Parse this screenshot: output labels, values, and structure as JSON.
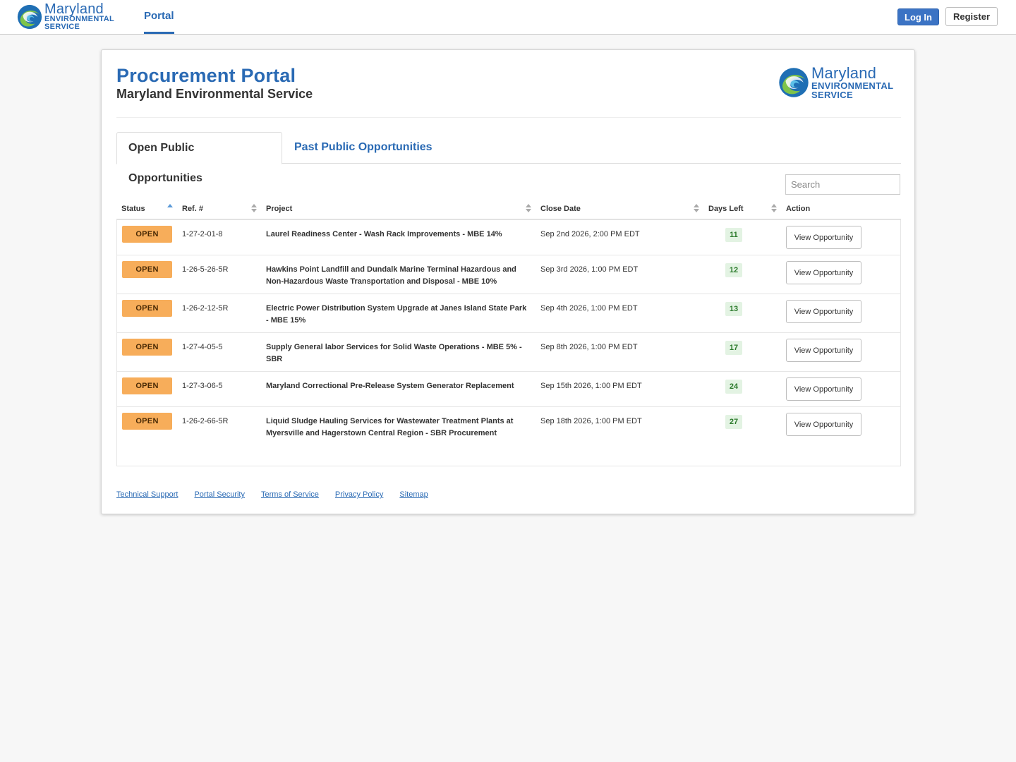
{
  "header": {
    "brand": {
      "word1": "Maryland",
      "word2": "ENVIRONMENTAL",
      "word3": "SERVICE"
    },
    "nav_portal": "Portal",
    "login_label": "Log In",
    "register_label": "Register"
  },
  "card": {
    "title": "Procurement Portal",
    "subtitle": "Maryland Environmental Service",
    "logo": {
      "word1": "Maryland",
      "word2": "ENVIRONMENTAL",
      "word3": "SERVICE"
    },
    "tabs": [
      {
        "label": "Open Public Opportunities",
        "active": true
      },
      {
        "label": "Past Public Opportunities",
        "active": false
      }
    ],
    "search_placeholder": "Search"
  },
  "table": {
    "columns": [
      "Status",
      "Ref. #",
      "Project",
      "Close Date",
      "Days Left",
      "Action"
    ],
    "rows": [
      {
        "status": "OPEN",
        "ref": "1-27-2-01-8",
        "project": "Laurel Readiness Center - Wash Rack Improvements - MBE 14%",
        "close": "Sep 2nd 2026, 2:00 PM EDT",
        "days": "11",
        "action": "View Opportunity"
      },
      {
        "status": "OPEN",
        "ref": "1-26-5-26-5R",
        "project": "Hawkins Point Landfill and Dundalk Marine Terminal Hazardous and Non-Hazardous Waste Transportation and Disposal - MBE 10%",
        "close": "Sep 3rd 2026, 1:00 PM EDT",
        "days": "12",
        "action": "View Opportunity"
      },
      {
        "status": "OPEN",
        "ref": "1-26-2-12-5R",
        "project": "Electric Power Distribution System Upgrade at Janes Island State Park - MBE 15%",
        "close": "Sep 4th 2026, 1:00 PM EDT",
        "days": "13",
        "action": "View Opportunity"
      },
      {
        "status": "OPEN",
        "ref": "1-27-4-05-5",
        "project": "Supply General labor Services for Solid Waste Operations - MBE 5% - SBR",
        "close": "Sep 8th 2026, 1:00 PM EDT",
        "days": "17",
        "action": "View Opportunity"
      },
      {
        "status": "OPEN",
        "ref": "1-27-3-06-5",
        "project": "Maryland Correctional Pre-Release System Generator Replacement",
        "close": "Sep 15th 2026, 1:00 PM EDT",
        "days": "24",
        "action": "View Opportunity"
      },
      {
        "status": "OPEN",
        "ref": "1-26-2-66-5R",
        "project": "Liquid Sludge Hauling Services for Wastewater Treatment Plants at Myersville and Hagerstown Central Region - SBR Procurement",
        "close": "Sep 18th 2026, 1:00 PM EDT",
        "days": "27",
        "action": "View Opportunity"
      }
    ]
  },
  "footer": {
    "links": [
      "Technical Support",
      "Portal Security",
      "Terms of Service",
      "Privacy Policy",
      "Sitemap"
    ]
  },
  "colors": {
    "brand_blue": "#2a6ab4",
    "status_open": "#f7ad5a",
    "days_badge_bg": "#e3f3e3",
    "days_badge_fg": "#2b7a2b"
  }
}
